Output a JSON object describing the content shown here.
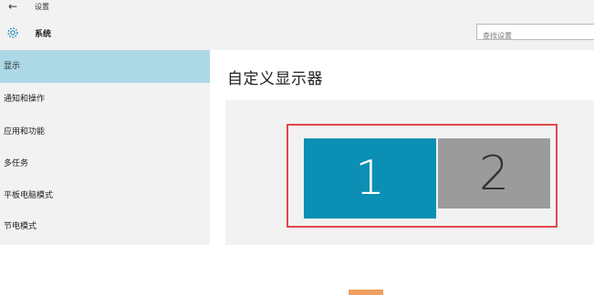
{
  "header": {
    "back_icon": "left-arrow-icon",
    "window_title": "设置",
    "section_icon": "gear-icon",
    "section_title": "系统",
    "search": {
      "placeholder": "查找设置",
      "value": ""
    }
  },
  "sidebar": {
    "items": [
      {
        "label": "显示",
        "active": true
      },
      {
        "label": "通知和操作",
        "active": false
      },
      {
        "label": "应用和功能",
        "active": false
      },
      {
        "label": "多任务",
        "active": false
      },
      {
        "label": "平板电脑模式",
        "active": false
      },
      {
        "label": "节电模式",
        "active": false
      }
    ]
  },
  "main": {
    "title": "自定义显示器",
    "monitors": [
      {
        "label": "1",
        "selected": true,
        "color": "#0b8fb5"
      },
      {
        "label": "2",
        "selected": false,
        "color": "#9b9b9b"
      }
    ]
  },
  "colors": {
    "accent": "#0b8fb5",
    "sidebar_active": "#add8e6",
    "highlight": "#e0474c"
  }
}
